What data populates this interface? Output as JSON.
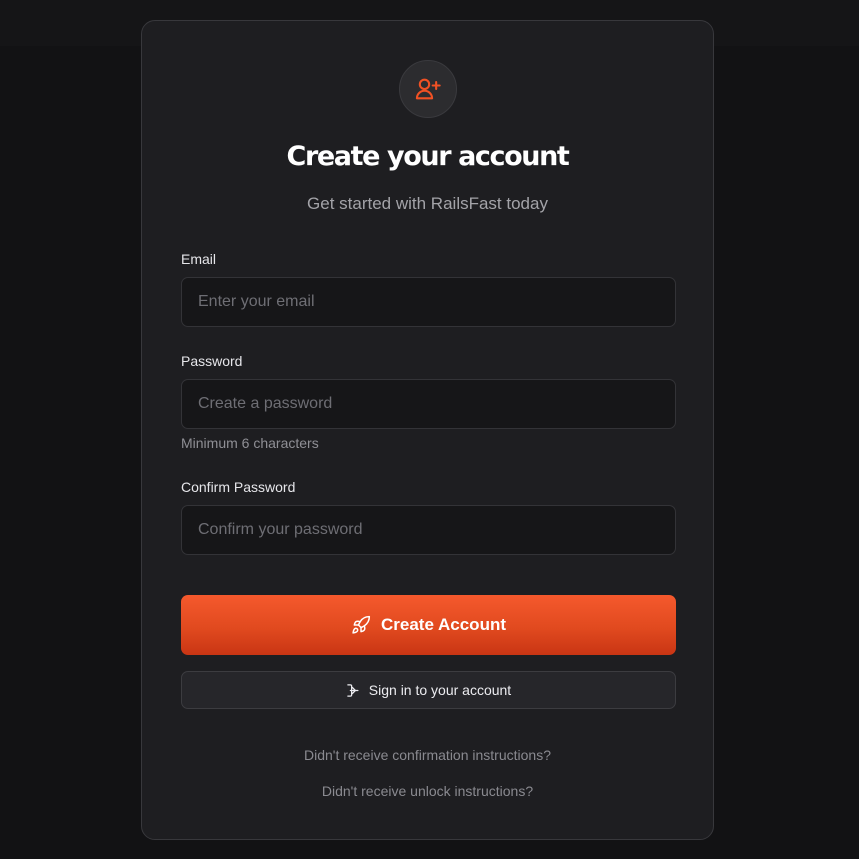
{
  "header": {
    "icon": "user-plus-icon",
    "title": "Create your account",
    "subtitle": "Get started with RailsFast today"
  },
  "form": {
    "email": {
      "label": "Email",
      "placeholder": "Enter your email",
      "value": ""
    },
    "password": {
      "label": "Password",
      "placeholder": "Create a password",
      "value": "",
      "hint": "Minimum 6 characters"
    },
    "confirm_password": {
      "label": "Confirm Password",
      "placeholder": "Confirm your password",
      "value": ""
    }
  },
  "actions": {
    "create_account": {
      "label": "Create Account",
      "icon": "rocket-icon"
    },
    "sign_in": {
      "label": "Sign in to your account",
      "icon": "sign-in-icon"
    }
  },
  "links": {
    "confirmation": "Didn't receive confirmation instructions?",
    "unlock": "Didn't receive unlock instructions?"
  },
  "colors": {
    "accent": "#f05124",
    "background": "#121214",
    "card": "#1e1e21"
  }
}
